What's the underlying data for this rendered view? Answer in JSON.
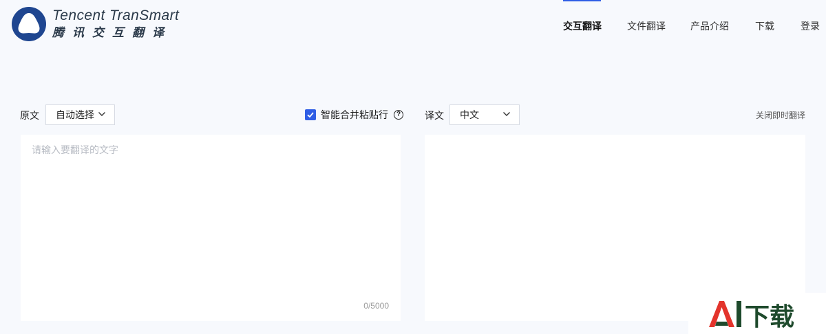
{
  "logo": {
    "en": "Tencent TranSmart",
    "cn": "腾讯交互翻译"
  },
  "nav": {
    "items": [
      {
        "label": "交互翻译",
        "active": true
      },
      {
        "label": "文件翻译",
        "active": false
      },
      {
        "label": "产品介绍",
        "active": false
      },
      {
        "label": "下载",
        "active": false
      },
      {
        "label": "登录",
        "active": false
      }
    ]
  },
  "source": {
    "label": "原文",
    "language": "自动选择",
    "placeholder": "请输入要翻译的文字",
    "counter": "0/5000"
  },
  "merge_paste": {
    "label": "智能合并粘贴行",
    "checked": true
  },
  "target": {
    "label": "译文",
    "language": "中文",
    "close_instant": "关闭即时翻译"
  },
  "watermark": {
    "text": "AI下载"
  },
  "colors": {
    "accent": "#2f5ee5",
    "background": "#f7f9fd",
    "logo_blue": "#1f4690",
    "watermark_red": "#e3342c",
    "watermark_dark": "#1e4a2c"
  }
}
